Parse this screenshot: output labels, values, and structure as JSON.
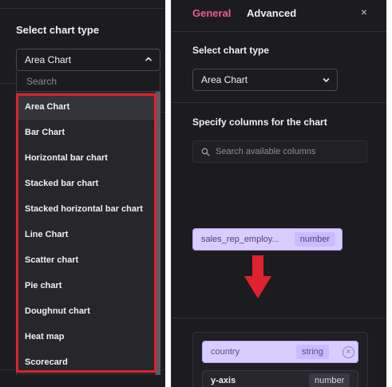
{
  "left_panel": {
    "title": "Select chart type",
    "selected_value": "Area Chart",
    "search": {
      "placeholder": "Search"
    },
    "options": [
      {
        "label": "Area Chart",
        "selected": true
      },
      {
        "label": "Bar Chart"
      },
      {
        "label": "Horizontal bar chart"
      },
      {
        "label": "Stacked bar chart"
      },
      {
        "label": "Stacked horizontal bar chart"
      },
      {
        "label": "Line Chart"
      },
      {
        "label": "Scatter chart"
      },
      {
        "label": "Pie chart"
      },
      {
        "label": "Doughnut chart"
      },
      {
        "label": "Heat map"
      },
      {
        "label": "Scorecard"
      }
    ]
  },
  "right_panel": {
    "tabs": [
      {
        "label": "General",
        "active": true
      },
      {
        "label": "Advanced"
      }
    ],
    "close_label": "×",
    "chart_type_title": "Select chart type",
    "chart_type_value": "Area Chart",
    "columns_title": "Specify columns for the chart",
    "columns_search": {
      "placeholder": "Search available columns"
    },
    "dragged_column": {
      "name": "sales_rep_employ...",
      "type": "number"
    },
    "x_axis_column": {
      "name": "country",
      "type": "string",
      "remove_label": "×"
    },
    "y_axis": {
      "label": "y-axis",
      "type": "number"
    }
  },
  "colors": {
    "background": "#1c1c20",
    "accent_pink": "#e85a92",
    "chip_purple": "#d9ccff",
    "highlight_red": "#e0222e"
  },
  "icons": [
    "chevron-up-icon",
    "chevron-down-icon",
    "search-icon",
    "close-icon",
    "down-arrow-icon",
    "remove-circle-icon"
  ]
}
